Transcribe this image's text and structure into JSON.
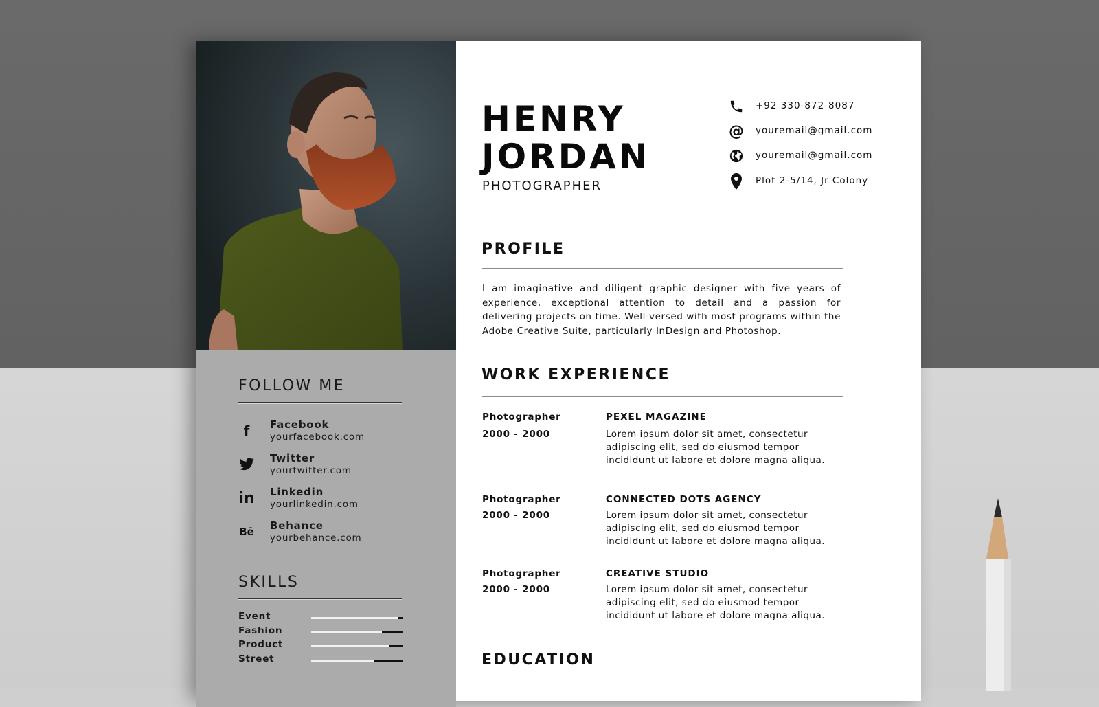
{
  "resume": {
    "first_name": "HENRY",
    "last_name": "JORDAN",
    "role": "PHOTOGRAPHER",
    "contact": [
      {
        "icon": "phone-icon",
        "text": "+92 330-872-8087"
      },
      {
        "icon": "at-icon",
        "text": "youremail@gmail.com"
      },
      {
        "icon": "globe-icon",
        "text": "youremail@gmail.com"
      },
      {
        "icon": "location-pin-icon",
        "text": "Plot 2-5/14, Jr Colony"
      }
    ],
    "profile": {
      "heading": "PROFILE",
      "text": "I am imaginative and diligent graphic designer with five years of experience, exceptional attention to detail and a passion for delivering projects on time. Well-versed with most programs within the Adobe Creative Suite, particularly InDesign and Photoshop."
    },
    "work_experience": {
      "heading": "WORK EXPERIENCE",
      "jobs": [
        {
          "title": "Photographer",
          "dates": "2000 - 2000",
          "company": "PEXEL MAGAZINE",
          "description": "Lorem ipsum dolor sit amet, consectetur adipiscing elit, sed do eiusmod tempor incididunt ut labore et dolore magna aliqua."
        },
        {
          "title": "Photographer",
          "dates": "2000 - 2000",
          "company": "CONNECTED DOTS AGENCY",
          "description": "Lorem ipsum dolor sit amet, consectetur adipiscing elit, sed do eiusmod tempor incididunt ut labore et dolore magna aliqua."
        },
        {
          "title": "Photographer",
          "dates": "2000 - 2000",
          "company": "CREATIVE STUDIO",
          "description": "Lorem ipsum dolor sit amet, consectetur adipiscing elit, sed do eiusmod tempor incididunt ut labore et dolore magna aliqua."
        }
      ]
    },
    "education": {
      "heading": "EDUCATION"
    },
    "follow_me": {
      "heading": "FOLLOW ME",
      "items": [
        {
          "icon": "facebook-icon",
          "glyph": "f",
          "name": "Facebook",
          "url": "yourfacebook.com"
        },
        {
          "icon": "twitter-icon",
          "glyph": "",
          "name": "Twitter",
          "url": "yourtwitter.com"
        },
        {
          "icon": "linkedin-icon",
          "glyph": "in",
          "name": "Linkedin",
          "url": "yourlinkedin.com"
        },
        {
          "icon": "behance-icon",
          "glyph": "Bē",
          "name": "Behance",
          "url": "yourbehance.com"
        }
      ]
    },
    "skills": {
      "heading": "SKILLS",
      "items": [
        {
          "name": "Event",
          "level": 0.94
        },
        {
          "name": "Fashion",
          "level": 0.77
        },
        {
          "name": "Product",
          "level": 0.85
        },
        {
          "name": "Street",
          "level": 0.68
        }
      ]
    }
  },
  "colors": {
    "sidebar": "#ababab",
    "backdrop_top": "#666666",
    "backdrop_bottom": "#d2d2d2",
    "text": "#111111"
  }
}
